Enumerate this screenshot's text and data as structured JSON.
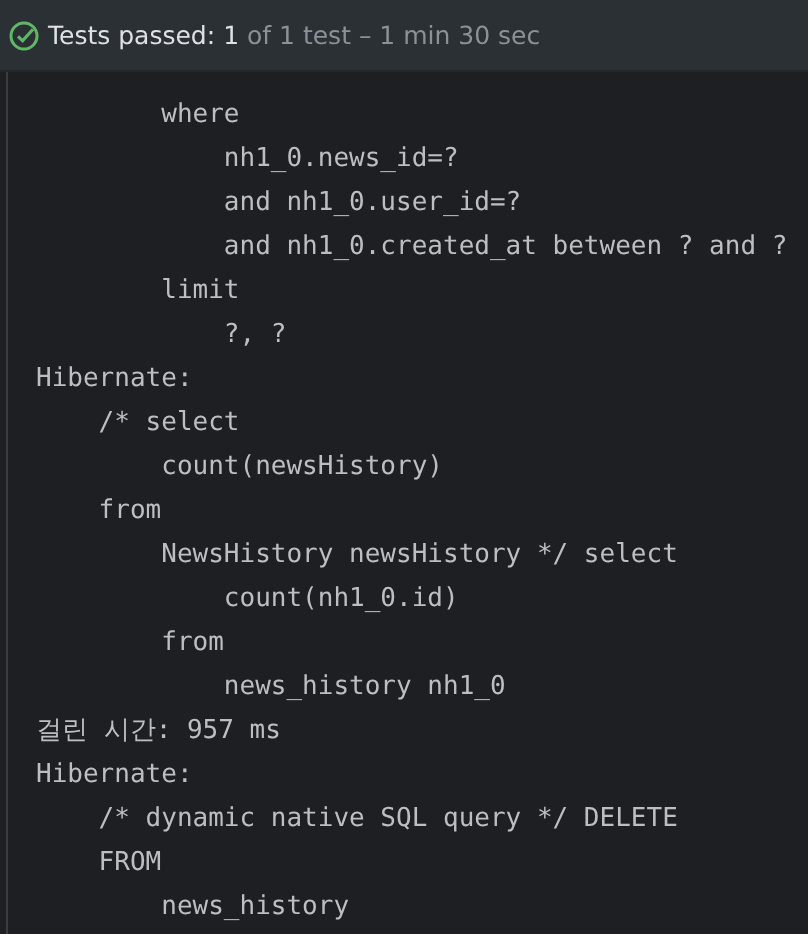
{
  "status": {
    "label": "Tests passed:",
    "passed": "1",
    "summary": "of 1 test – 1 min 30 sec"
  },
  "console_lines": [
    "        where",
    "            nh1_0.news_id=?",
    "            and nh1_0.user_id=?",
    "            and nh1_0.created_at between ? and ?",
    "        limit",
    "            ?, ?",
    "Hibernate: ",
    "    /* select",
    "        count(newsHistory) ",
    "    from",
    "        NewsHistory newsHistory */ select",
    "            count(nh1_0.id) ",
    "        from",
    "            news_history nh1_0",
    "걸린 시간: 957 ms",
    "Hibernate: ",
    "    /* dynamic native SQL query */ DELETE ",
    "    FROM",
    "        news_history"
  ]
}
